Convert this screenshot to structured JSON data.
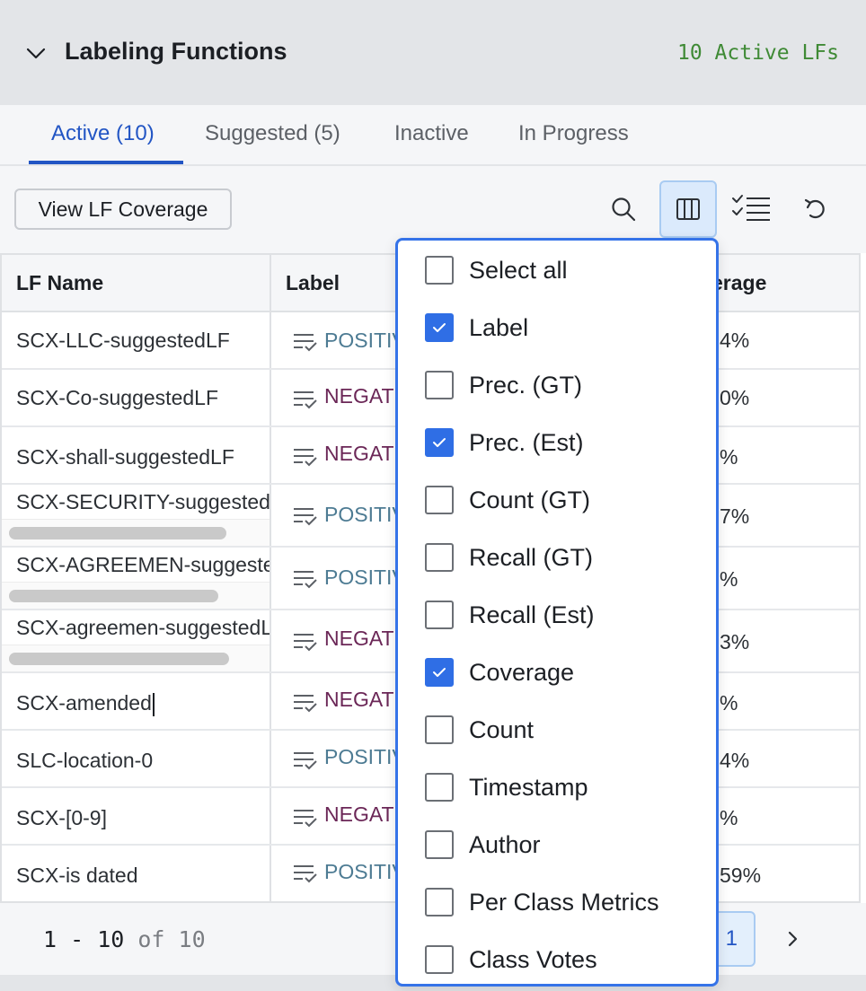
{
  "panel": {
    "title": "Labeling Functions",
    "active_count": "10 Active LFs"
  },
  "tabs": [
    {
      "label": "Active (10)",
      "active": true
    },
    {
      "label": "Suggested (5)",
      "active": false
    },
    {
      "label": "Inactive",
      "active": false
    },
    {
      "label": "In Progress",
      "active": false
    }
  ],
  "toolbar": {
    "coverage_button": "View LF Coverage",
    "icons": [
      "search-icon",
      "columns-icon",
      "checklist-icon",
      "undo-icon"
    ]
  },
  "table": {
    "columns": [
      "LF Name",
      "Label",
      "Coverage"
    ],
    "columns_visible_text": [
      "LF Name",
      "Label",
      "erage"
    ],
    "rows": [
      {
        "name": "SCX-LLC-suggestedLF",
        "label": "POSITIVE",
        "label_visible": "POSITIV",
        "coverage_visible": "4%"
      },
      {
        "name": "SCX-Co-suggestedLF",
        "label": "NEGATIVE",
        "label_visible": "NEGAT",
        "coverage_visible": "0%"
      },
      {
        "name": "SCX-shall-suggestedLF",
        "label": "NEGATIVE",
        "label_visible": "NEGAT",
        "coverage_visible": "%"
      },
      {
        "name": "SCX-SECURITY-suggestedLF",
        "label": "POSITIVE",
        "label_visible": "POSITIV",
        "coverage_visible": "7%"
      },
      {
        "name": "SCX-AGREEMEN-suggestedLF",
        "label": "POSITIVE",
        "label_visible": "POSITIV",
        "coverage_visible": "%"
      },
      {
        "name": "SCX-agreemen-suggestedLF",
        "label": "NEGATIVE",
        "label_visible": "NEGAT",
        "coverage_visible": "3%"
      },
      {
        "name": "SCX-amended",
        "label": "NEGATIVE",
        "label_visible": "NEGAT",
        "coverage_visible": "%"
      },
      {
        "name": "SLC-location-0",
        "label": "POSITIVE",
        "label_visible": "POSITIV",
        "coverage_visible": "4%"
      },
      {
        "name": "SCX-[0-9]",
        "label": "NEGATIVE",
        "label_visible": "NEGAT",
        "coverage_visible": "%"
      },
      {
        "name": "SCX-is dated",
        "label": "POSITIVE",
        "label_visible": "POSITIV",
        "coverage_visible": "59%"
      }
    ]
  },
  "pagination": {
    "range": "1 - 10",
    "of_text": "of 10",
    "current_page": "1"
  },
  "column_menu": {
    "options": [
      {
        "label": "Select all",
        "checked": false
      },
      {
        "label": "Label",
        "checked": true
      },
      {
        "label": "Prec. (GT)",
        "checked": false
      },
      {
        "label": "Prec. (Est)",
        "checked": true
      },
      {
        "label": "Count (GT)",
        "checked": false
      },
      {
        "label": "Recall (GT)",
        "checked": false
      },
      {
        "label": "Recall (Est)",
        "checked": false
      },
      {
        "label": "Coverage",
        "checked": true
      },
      {
        "label": "Count",
        "checked": false
      },
      {
        "label": "Timestamp",
        "checked": false
      },
      {
        "label": "Author",
        "checked": false
      },
      {
        "label": "Per Class Metrics",
        "checked": false
      },
      {
        "label": "Class Votes",
        "checked": false
      }
    ]
  },
  "colors": {
    "accent": "#2255c4",
    "checkbox_checked": "#2f6ee5",
    "positive_label": "#4d7b93",
    "negative_label": "#6b2757",
    "active_lfs": "#3f8a35"
  }
}
